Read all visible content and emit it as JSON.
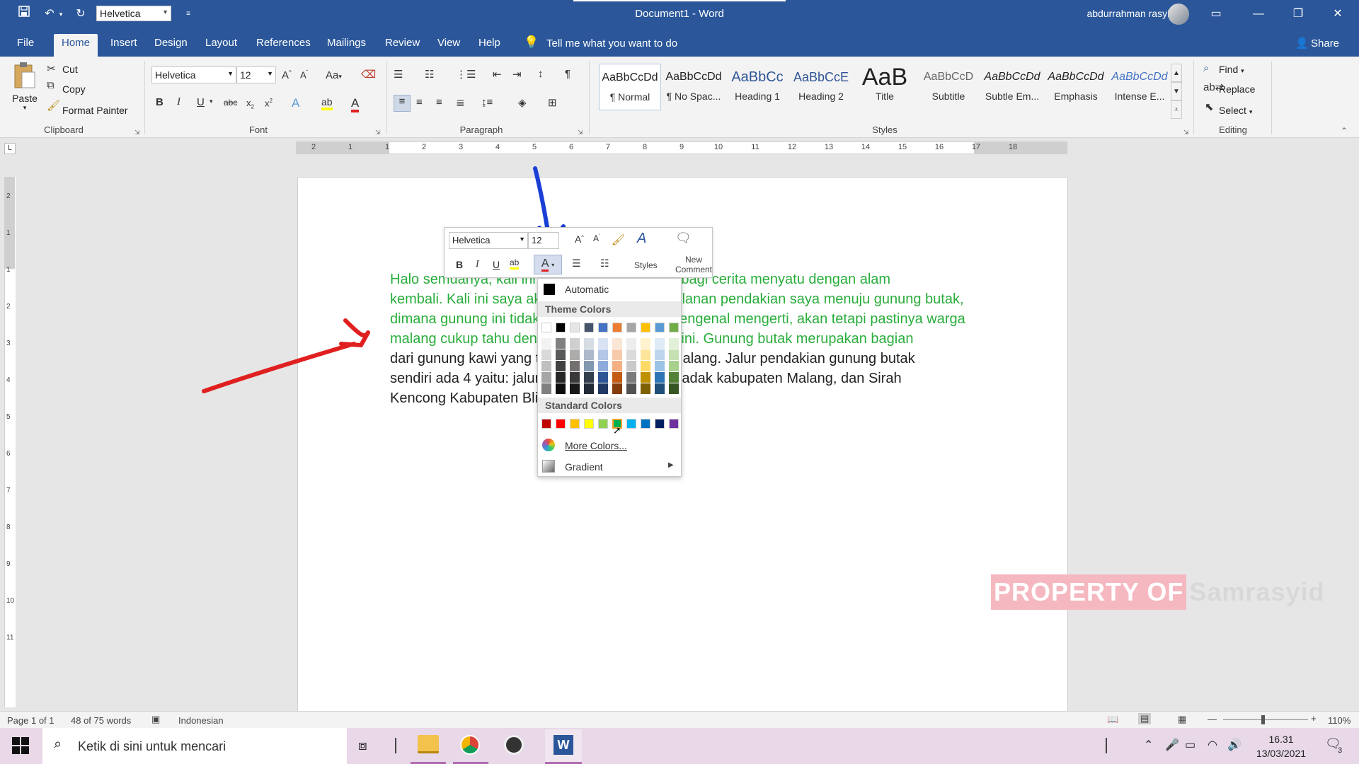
{
  "titlebar": {
    "title": "Document1  -  Word",
    "font_box": "Helvetica",
    "user": "abdurrahman rasyid"
  },
  "tabs": [
    {
      "label": "File"
    },
    {
      "label": "Home"
    },
    {
      "label": "Insert"
    },
    {
      "label": "Design"
    },
    {
      "label": "Layout"
    },
    {
      "label": "References"
    },
    {
      "label": "Mailings"
    },
    {
      "label": "Review"
    },
    {
      "label": "View"
    },
    {
      "label": "Help"
    }
  ],
  "tell_me": "Tell me what you want to do",
  "share": "Share",
  "clipboard": {
    "paste": "Paste",
    "cut": "Cut",
    "copy": "Copy",
    "format_painter": "Format Painter",
    "label": "Clipboard"
  },
  "font": {
    "name": "Helvetica",
    "size": "12",
    "label": "Font",
    "change_case": "Aa"
  },
  "paragraph": {
    "label": "Paragraph"
  },
  "styles": {
    "label": "Styles",
    "items": [
      {
        "preview": "AaBbCcDd",
        "name": "¶ Normal"
      },
      {
        "preview": "AaBbCcDd",
        "name": "¶ No Spac..."
      },
      {
        "preview": "AaBbCc",
        "name": "Heading 1"
      },
      {
        "preview": "AaBbCcE",
        "name": "Heading 2"
      },
      {
        "preview": "AaB",
        "name": "Title"
      },
      {
        "preview": "AaBbCcD",
        "name": "Subtitle"
      },
      {
        "preview": "AaBbCcDd",
        "name": "Subtle Em..."
      },
      {
        "preview": "AaBbCcDd",
        "name": "Emphasis"
      },
      {
        "preview": "AaBbCcDd",
        "name": "Intense E..."
      }
    ]
  },
  "editing": {
    "find": "Find",
    "replace": "Replace",
    "select": "Select",
    "label": "Editing"
  },
  "ruler_h": [
    "2",
    "1",
    "1",
    "2",
    "3",
    "4",
    "5",
    "6",
    "7",
    "8",
    "9",
    "10",
    "11",
    "12",
    "13",
    "14",
    "15",
    "16",
    "17",
    "18"
  ],
  "ruler_v": [
    "2",
    "1",
    "1",
    "2",
    "3",
    "4",
    "5",
    "6",
    "7",
    "8",
    "9",
    "10",
    "11"
  ],
  "document": {
    "green_lines": [
      "Halo semuanya, kali ini saya akan kembali berbagi cerita menyatu dengan alam",
      "kembali. Kali ini saya akan berbagi cerita perjalanan pendakian saya menuju gunung butak,",
      "dimana gunung ini tidak banyak orang yang mengenal mengerti, akan tetapi pastinya warga",
      "malang cukup tahu dengan gunung yang satu ini. Gunung butak merupakan bagian"
    ],
    "black_lines": [
      "dari gunung kawi yang terletak di kabupaten Malang. Jalur pendakian gunung butak",
      "sendiri ada 4 yaitu: jalur Panderman, Princi, Gladak kabupaten Malang, dan Sirah",
      "Kencong Kabupaten Blitar."
    ]
  },
  "minitoolbar": {
    "font": "Helvetica",
    "size": "12",
    "styles": "Styles",
    "new_comment_1": "New",
    "new_comment_2": "Comment"
  },
  "color_menu": {
    "automatic": "Automatic",
    "theme_colors": "Theme Colors",
    "standard_colors": "Standard Colors",
    "more_colors": "More Colors...",
    "gradient": "Gradient",
    "theme_top": [
      "#ffffff",
      "#000000",
      "#e7e6e6",
      "#44546a",
      "#4472c4",
      "#ed7d31",
      "#a5a5a5",
      "#ffc000",
      "#5b9bd5",
      "#70ad47"
    ],
    "theme_shades": [
      [
        "#f2f2f2",
        "#d9d9d9",
        "#bfbfbf",
        "#a6a6a6",
        "#808080"
      ],
      [
        "#808080",
        "#595959",
        "#404040",
        "#262626",
        "#0d0d0d"
      ],
      [
        "#d0cece",
        "#aeabab",
        "#757070",
        "#3a3838",
        "#171717"
      ],
      [
        "#d6dce4",
        "#adb9ca",
        "#8497b0",
        "#333f4f",
        "#222a35"
      ],
      [
        "#d9e2f3",
        "#b4c6e7",
        "#8eaadb",
        "#2f5496",
        "#1f3864"
      ],
      [
        "#fbe5d5",
        "#f7caac",
        "#f4b083",
        "#c55a11",
        "#833c0b"
      ],
      [
        "#ededed",
        "#dbdbdb",
        "#c9c9c9",
        "#7b7b7b",
        "#525252"
      ],
      [
        "#fff2cc",
        "#fee599",
        "#ffd966",
        "#bf9000",
        "#7f6000"
      ],
      [
        "#deeaf6",
        "#bdd6ee",
        "#9cc2e5",
        "#2e75b5",
        "#1f4e79"
      ],
      [
        "#e2efd9",
        "#c5e0b3",
        "#a8d08d",
        "#538135",
        "#375623"
      ]
    ],
    "standard": [
      "#c00000",
      "#ff0000",
      "#ffc000",
      "#ffff00",
      "#92d050",
      "#00b050",
      "#00b0f0",
      "#0070c0",
      "#002060",
      "#7030a0"
    ]
  },
  "status": {
    "page": "Page 1 of 1",
    "words": "48 of 75 words",
    "language": "Indonesian",
    "zoom": "110%"
  },
  "taskbar": {
    "search": "Ketik di sini untuk mencari",
    "time": "16.31",
    "date": "13/03/2021",
    "notifications": "3"
  },
  "watermark": {
    "part1": "PROPERTY OF",
    "part2": "Samrasyid"
  },
  "colors": {
    "word_blue": "#2b579a",
    "green_text": "#2aad3c",
    "arrow_red": "#e02020",
    "arrow_blue": "#1a3fd6"
  }
}
